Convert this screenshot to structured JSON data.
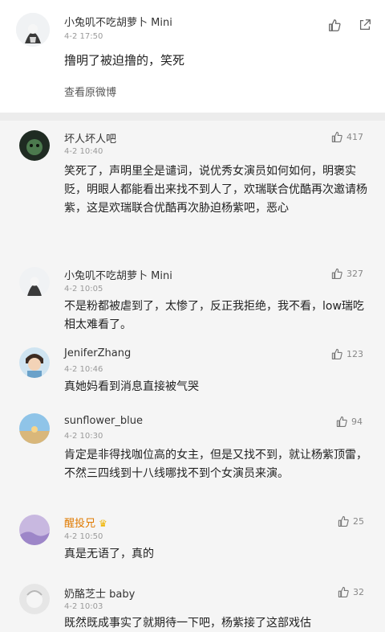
{
  "original_post": {
    "username": "小兔叽不吃胡萝卜 Mini",
    "badge": "Mini",
    "date": "4-2 17:50",
    "text": "撸明了被迫撸的，笑死",
    "link": "查看原微博"
  },
  "comments": [
    {
      "username": "坏人坏人吧",
      "date": "4-2 10:40",
      "likes": "417",
      "text": "笑死了，声明里全是谴词，说优秀女演员如何如何，明褒实贬，明眼人都能看出来找不到人了，欢瑞联合优酷再次邀请杨紫，这是欢瑞联合优酷再次胁迫杨紫吧，恶心"
    },
    {
      "username": "小兔叽不吃胡萝卜 Mini",
      "date": "4-2 10:05",
      "likes": "327",
      "text": "不是粉都被虐到了，太惨了，反正我拒绝，我不看，low瑞吃相太难看了。"
    },
    {
      "username": "JeniferZhang",
      "date": "4-2 10:46",
      "likes": "123",
      "text": "真她妈看到消息直接被气哭"
    },
    {
      "username": "sunflower_blue",
      "date": "4-2 10:30",
      "likes": "94",
      "text": "肯定是非得找咖位高的女主，但是又找不到，就让杨紫顶雷，不然三四线到十八线哪找不到个女演员来演。"
    },
    {
      "username": "醒投兄",
      "date": "4-2 10:50",
      "likes": "25",
      "text": "真是无语了，真的"
    },
    {
      "username": "奶酪芝士 baby",
      "date": "4-2 10:03",
      "likes": "32",
      "text": "既然既成事实了就期待一下吧，杨紫接了这部戏估"
    }
  ],
  "colors": {
    "separator": "#ececec",
    "list_bg": "#f5f5f5",
    "badge": "#8aa4cc"
  },
  "icons": [
    "thumb-up-icon",
    "share-icon",
    "repost-icon"
  ]
}
